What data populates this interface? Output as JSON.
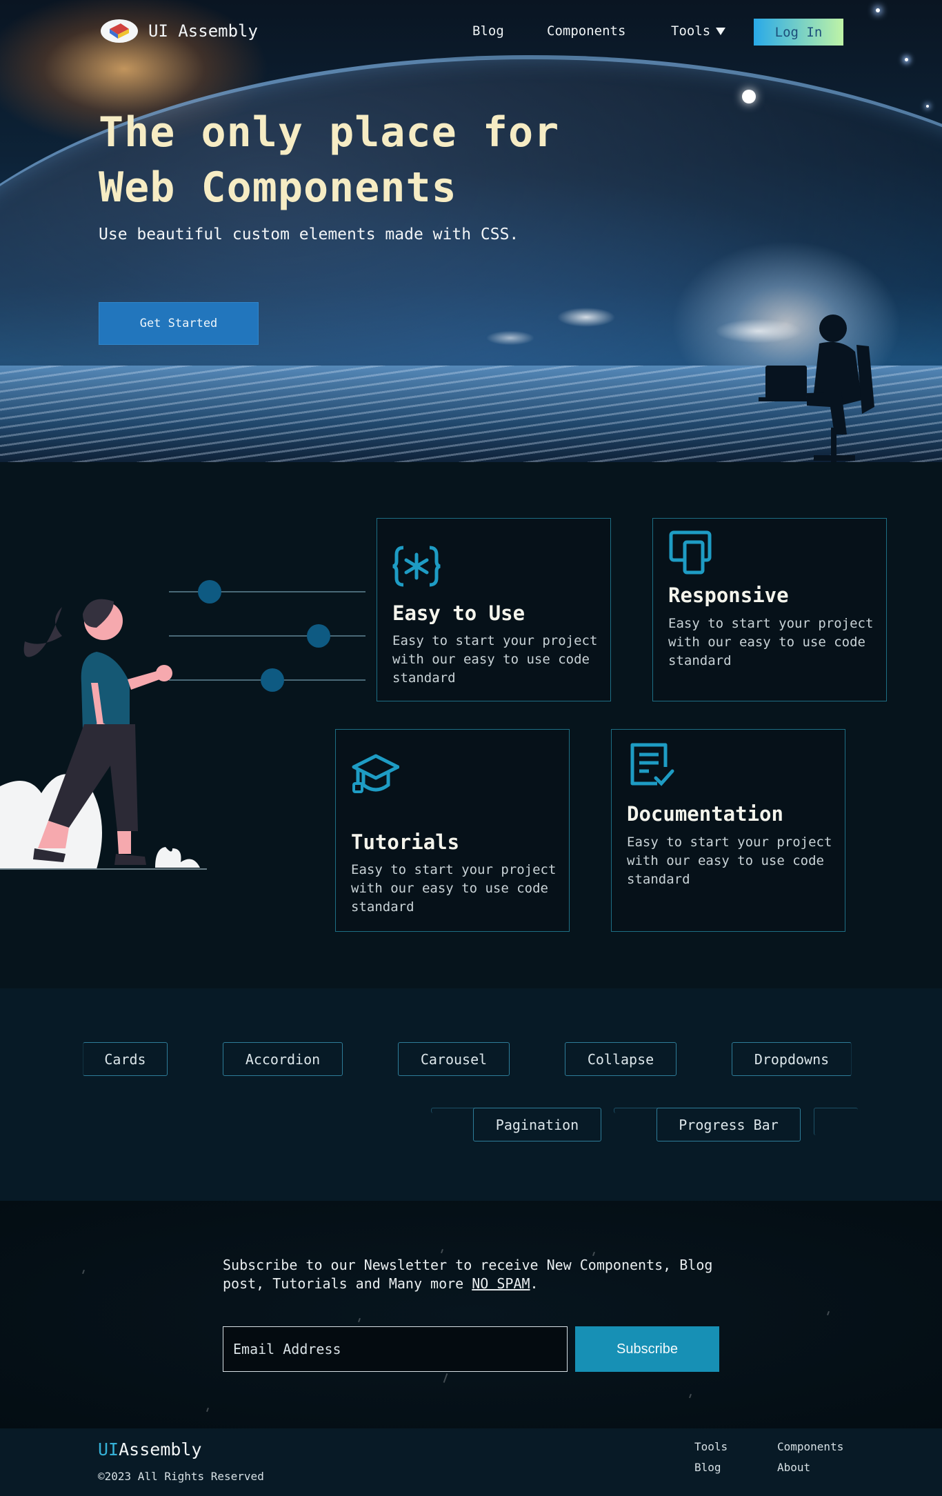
{
  "nav": {
    "logo_text": "UI Assembly",
    "links": [
      "Blog",
      "Components",
      "Tools"
    ],
    "login": "Log In"
  },
  "hero": {
    "title_line1": "The only place for",
    "title_line2": "Web Components",
    "subtitle": "Use beautiful custom elements made with CSS.",
    "cta": "Get Started"
  },
  "features": [
    {
      "title": "Easy to Use",
      "text": "Easy to start your project with our easy to use code standard",
      "icon": "braces-asterisk-icon"
    },
    {
      "title": "Responsive",
      "text": "Easy to start your project with our easy to use code standard",
      "icon": "devices-icon"
    },
    {
      "title": "Tutorials",
      "text": "Easy to start your project with our easy to use code standard",
      "icon": "graduation-cap-icon"
    },
    {
      "title": "Documentation",
      "text": "Easy to start your project with our easy to use code standard",
      "icon": "document-check-icon"
    }
  ],
  "tags": [
    "Cards",
    "Accordion",
    "Carousel",
    "Collapse",
    "Dropdowns",
    "Pagination",
    "Progress Bar"
  ],
  "newsletter": {
    "text_before": "Subscribe to our Newsletter to receive New Components, Blog post, Tutorials and Many more ",
    "no_spam": "NO SPAM",
    "text_after": ".",
    "placeholder": "Email Address",
    "button": "Subscribe"
  },
  "footer": {
    "logo_ui": "UI",
    "logo_rest": "Assembly",
    "copyright": "©2023 All Rights Reserved",
    "links": [
      "Tools",
      "Components",
      "Blog",
      "About"
    ]
  },
  "colors": {
    "accent": "#1790b5",
    "title": "#f6ecc4",
    "card_border": "#1e6f85",
    "cta": "#2276bd"
  }
}
